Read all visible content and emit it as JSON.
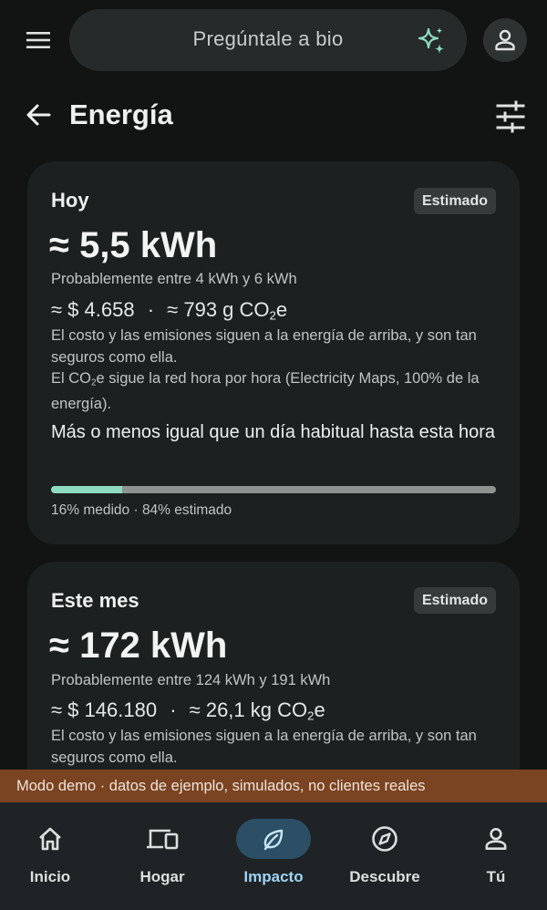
{
  "topbar": {
    "menu_icon": "menu-icon",
    "search_placeholder": "Pregúntale a bio",
    "sparkle_icon": "sparkle-icon",
    "account_icon": "person-icon"
  },
  "header": {
    "back_icon": "arrow-back-icon",
    "title": "Energía",
    "filter_icon": "tune-icon"
  },
  "today_card": {
    "title": "Hoy",
    "badge": "Estimado",
    "value": "≈ 5,5 kWh",
    "range": "Probablemente entre 4 kWh y 6 kWh",
    "cost": "≈ $ 4.658",
    "separator": "·",
    "emissions_prefix": "≈ 793 g CO",
    "emissions_sub": "2",
    "emissions_suffix": "e",
    "note_line1": "El costo y las emisiones siguen a la energía de arriba, y son tan seguros como ella.",
    "note_line2_prefix": "El CO",
    "note_line2_sub": "2",
    "note_line2_suffix": "e sigue la red hora por hora (Electricity Maps, 100% de la energía).",
    "comparison": "Más o menos igual que un día habitual hasta esta hora",
    "measured_fraction": 0.16,
    "progress_caption": "16% medido · 84% estimado"
  },
  "month_card": {
    "title": "Este mes",
    "badge": "Estimado",
    "value": "≈ 172 kWh",
    "range": "Probablemente entre 124 kWh y 191 kWh",
    "cost": "≈ $ 146.180",
    "separator": "·",
    "emissions_prefix": "≈ 26,1 kg CO",
    "emissions_sub": "2",
    "emissions_suffix": "e",
    "note_line1": "El costo y las emisiones siguen a la energía de arriba, y son tan seguros como ella."
  },
  "demo_banner": "Modo demo · datos de ejemplo, simulados, no clientes reales",
  "nav": {
    "items": [
      {
        "label": "Inicio",
        "icon": "home-icon"
      },
      {
        "label": "Hogar",
        "icon": "devices-icon"
      },
      {
        "label": "Impacto",
        "icon": "leaf-icon",
        "active": true
      },
      {
        "label": "Descubre",
        "icon": "compass-icon"
      },
      {
        "label": "Tú",
        "icon": "person-icon"
      }
    ]
  },
  "colors": {
    "background": "#121414",
    "card": "#1c2021",
    "accent_measured": "#8fdcc0",
    "active_nav": "#2c4f66",
    "demo_banner": "#7a4423"
  }
}
